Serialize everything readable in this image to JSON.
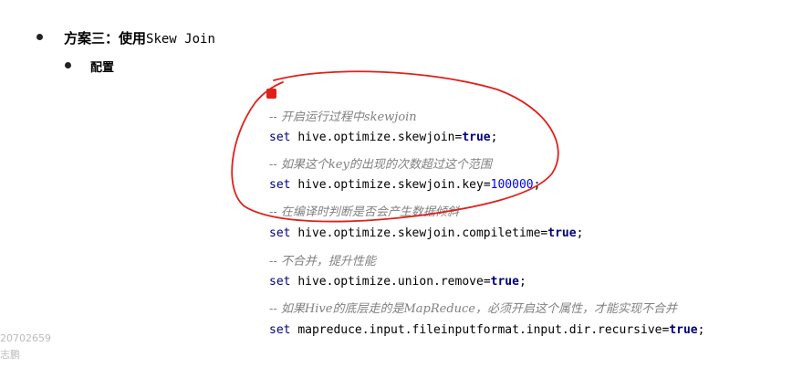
{
  "heading": {
    "cn": "方案三：使用",
    "en": "Skew Join"
  },
  "sub": "配置",
  "code": [
    {
      "type": "comment",
      "text": "-- 开启运行过程中skewjoin"
    },
    {
      "type": "set",
      "prefix": "set",
      "key": "hive.optimize.skewjoin",
      "op": "=",
      "value": "true",
      "suffix": ";"
    },
    {
      "type": "comment",
      "text": "-- 如果这个key的出现的次数超过这个范围"
    },
    {
      "type": "set",
      "prefix": "set",
      "key": "hive.optimize.skewjoin.key",
      "op": "=",
      "value": "100000",
      "suffix": ";"
    },
    {
      "type": "comment",
      "text": "-- 在编译时判断是否会产生数据倾斜"
    },
    {
      "type": "set",
      "prefix": "set",
      "key": "hive.optimize.skewjoin.compiletime",
      "op": "=",
      "value": "true",
      "suffix": ";"
    },
    {
      "type": "comment",
      "text": "-- 不合并，提升性能"
    },
    {
      "type": "set",
      "prefix": "set",
      "key": "hive.optimize.union.remove",
      "op": "=",
      "value": "true",
      "suffix": ";"
    },
    {
      "type": "comment",
      "text": "-- 如果Hive的底层走的是MapReduce，必须开启这个属性，才能实现不合并"
    },
    {
      "type": "set",
      "prefix": "set",
      "key": "mapreduce.input.fileinputformat.input.dir.recursive",
      "op": "=",
      "value": "true",
      "suffix": ";"
    }
  ],
  "watermark": {
    "line1": "20702659",
    "line2": "志鹏"
  },
  "colors": {
    "annotation": "#e0201a",
    "comment": "#808080",
    "keyword": "#00007f",
    "number": "#0000ff"
  }
}
